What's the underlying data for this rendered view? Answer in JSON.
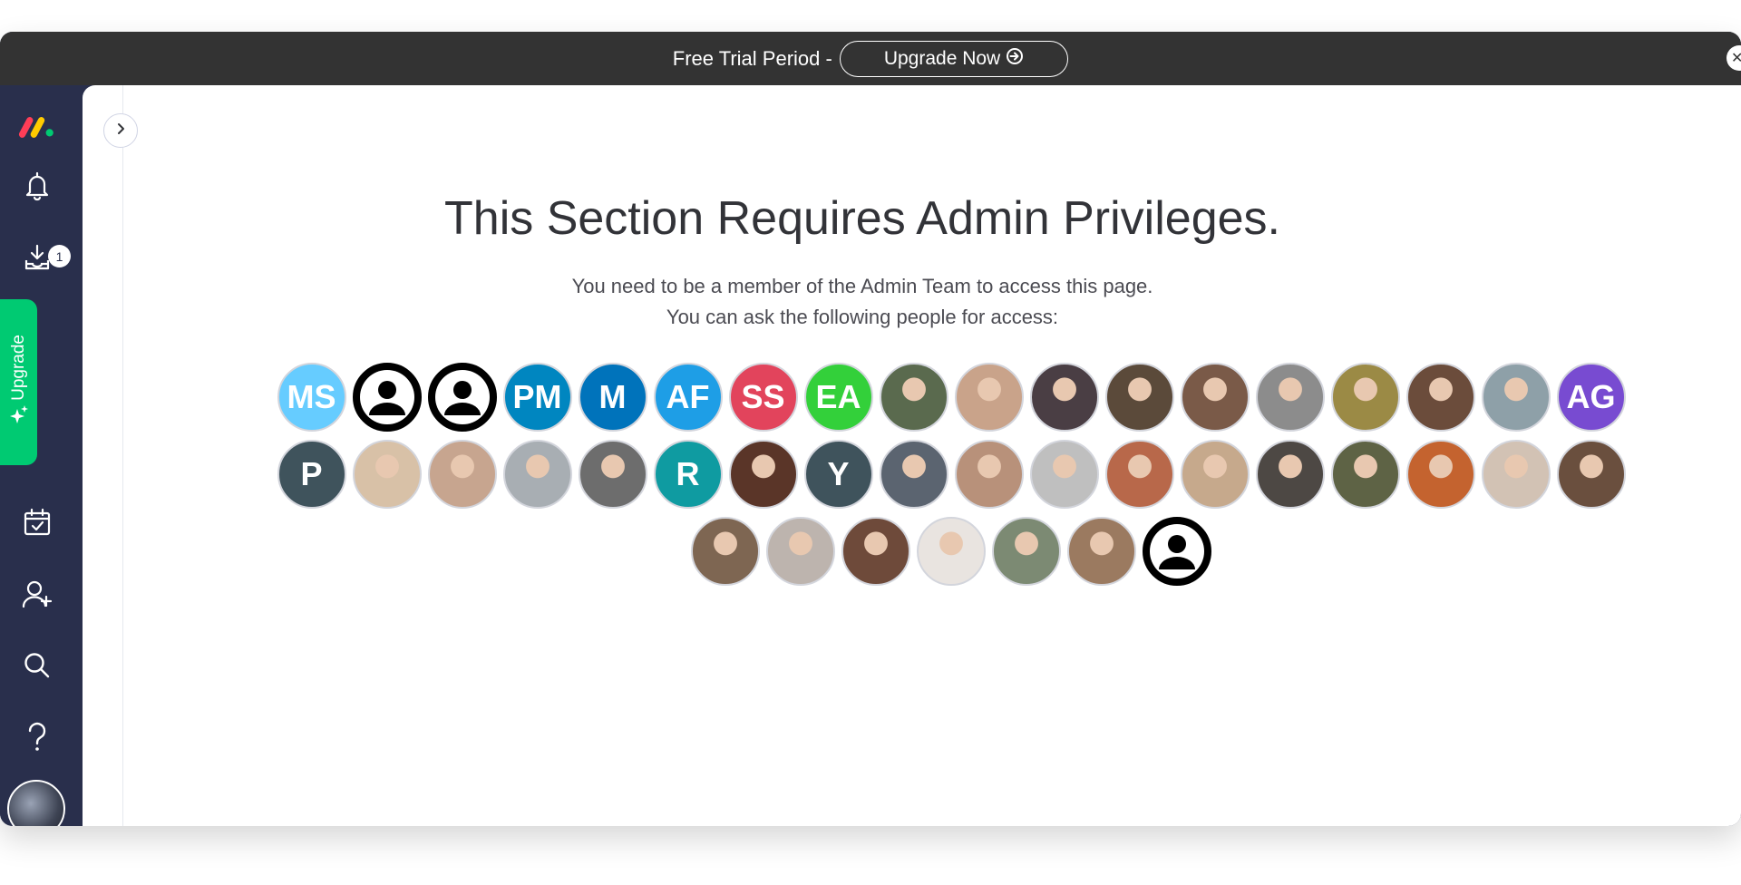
{
  "banner": {
    "text": "Free Trial Period -",
    "button_label": "Upgrade Now",
    "close_icon": "close-icon"
  },
  "sidebar": {
    "logo": "monday-logo",
    "items": [
      {
        "name": "notifications",
        "icon": "bell-icon"
      },
      {
        "name": "inbox",
        "icon": "inbox-download-icon",
        "badge": "1"
      },
      {
        "name": "my-work",
        "icon": "calendar-check-icon"
      },
      {
        "name": "invite",
        "icon": "add-user-icon"
      },
      {
        "name": "search",
        "icon": "search-icon"
      },
      {
        "name": "help",
        "icon": "question-icon"
      }
    ],
    "upgrade_label": "Upgrade"
  },
  "main": {
    "title": "This Section Requires Admin Privileges.",
    "subtitle_line1": "You need to be a member of the Admin Team to access this page.",
    "subtitle_line2": "You can ask the following people for access:"
  },
  "colors": {
    "sidebar_bg": "#292f4c",
    "banner_bg": "#333333",
    "upgrade_green": "#00ca72"
  },
  "people": [
    {
      "type": "initials",
      "text": "MS",
      "color": "#66ccff"
    },
    {
      "type": "blank"
    },
    {
      "type": "blank"
    },
    {
      "type": "initials",
      "text": "PM",
      "color": "#0086c0"
    },
    {
      "type": "initials",
      "text": "M",
      "color": "#0073bb"
    },
    {
      "type": "initials",
      "text": "AF",
      "color": "#1e9ee6"
    },
    {
      "type": "initials",
      "text": "SS",
      "color": "#e2445c"
    },
    {
      "type": "initials",
      "text": "EA",
      "color": "#33d03a"
    },
    {
      "type": "photo",
      "color": "#5a6a4e"
    },
    {
      "type": "photo",
      "color": "#c9a38a"
    },
    {
      "type": "photo",
      "color": "#4a3e44"
    },
    {
      "type": "photo",
      "color": "#5b4a3a"
    },
    {
      "type": "photo",
      "color": "#7a5a48"
    },
    {
      "type": "photo",
      "color": "#8c8c8c"
    },
    {
      "type": "photo",
      "color": "#9b8a45"
    },
    {
      "type": "photo",
      "color": "#6b4c3b"
    },
    {
      "type": "photo",
      "color": "#8ea0a8"
    },
    {
      "type": "initials",
      "text": "AG",
      "color": "#784bd1"
    },
    {
      "type": "initials",
      "text": "P",
      "color": "#3f535c"
    },
    {
      "type": "photo",
      "color": "#d8c1a7"
    },
    {
      "type": "photo",
      "color": "#c7a58f"
    },
    {
      "type": "photo",
      "color": "#a8aeb3"
    },
    {
      "type": "photo",
      "color": "#6d6d6d"
    },
    {
      "type": "initials",
      "text": "R",
      "color": "#0f9ba1"
    },
    {
      "type": "photo",
      "color": "#5a3528"
    },
    {
      "type": "initials",
      "text": "Y",
      "color": "#3f535c"
    },
    {
      "type": "photo",
      "color": "#5b6470"
    },
    {
      "type": "photo",
      "color": "#b8917a"
    },
    {
      "type": "photo",
      "color": "#bfbfbf"
    },
    {
      "type": "photo",
      "color": "#b8684a"
    },
    {
      "type": "photo",
      "color": "#c6a98c"
    },
    {
      "type": "photo",
      "color": "#4d4844"
    },
    {
      "type": "photo",
      "color": "#5e6345"
    },
    {
      "type": "photo",
      "color": "#c4632f"
    },
    {
      "type": "photo",
      "color": "#d2c2b4"
    },
    {
      "type": "photo",
      "color": "#6a4f3e"
    },
    {
      "type": "photo",
      "color": "#7e6652"
    },
    {
      "type": "photo",
      "color": "#bdb4ae"
    },
    {
      "type": "photo",
      "color": "#6e4a3a"
    },
    {
      "type": "photo",
      "color": "#e9e4e0"
    },
    {
      "type": "photo",
      "color": "#7c8a73"
    },
    {
      "type": "photo",
      "color": "#9b7a60"
    },
    {
      "type": "blank"
    }
  ]
}
